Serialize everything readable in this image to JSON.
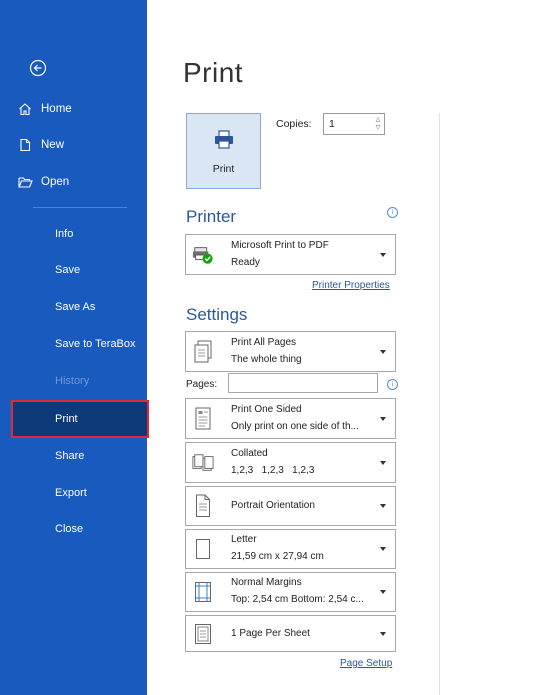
{
  "sidebar": {
    "top_items": [
      {
        "label": "Home",
        "icon": "home-icon"
      },
      {
        "label": "New",
        "icon": "new-document-icon"
      },
      {
        "label": "Open",
        "icon": "open-folder-icon"
      }
    ],
    "items": [
      {
        "label": "Info",
        "state": "normal"
      },
      {
        "label": "Save",
        "state": "normal"
      },
      {
        "label": "Save As",
        "state": "normal"
      },
      {
        "label": "Save to TeraBox",
        "state": "normal"
      },
      {
        "label": "History",
        "state": "disabled"
      },
      {
        "label": "Print",
        "state": "selected"
      },
      {
        "label": "Share",
        "state": "normal"
      },
      {
        "label": "Export",
        "state": "normal"
      },
      {
        "label": "Close",
        "state": "normal"
      }
    ]
  },
  "main": {
    "title": "Print",
    "print_button_label": "Print",
    "copies_label": "Copies:",
    "copies_value": "1",
    "printer_section": "Printer",
    "printer": {
      "name": "Microsoft Print to PDF",
      "status": "Ready"
    },
    "printer_properties_link": "Printer Properties",
    "settings_section": "Settings",
    "pages_label": "Pages:",
    "pages_value": "",
    "settings": [
      {
        "line1": "Print All Pages",
        "line2": "The whole thing",
        "icon": "pages-icon"
      },
      {
        "line1": "Print One Sided",
        "line2": "Only print on one side of th...",
        "icon": "one-sided-icon"
      },
      {
        "line1": "Collated",
        "line2": "1,2,3   1,2,3   1,2,3",
        "icon": "collated-icon"
      },
      {
        "line1": "Portrait Orientation",
        "line2": "",
        "icon": "portrait-icon"
      },
      {
        "line1": "Letter",
        "line2": "21,59 cm x 27,94 cm",
        "icon": "paper-size-icon"
      },
      {
        "line1": "Normal Margins",
        "line2": "Top: 2,54 cm Bottom: 2,54 c...",
        "icon": "margins-icon"
      },
      {
        "line1": "1 Page Per Sheet",
        "line2": "",
        "icon": "pages-per-sheet-icon"
      }
    ],
    "page_setup_link": "Page Setup"
  },
  "colors": {
    "sidebar_bg": "#185abd",
    "sidebar_selected": "#0d3a78",
    "selection_outline": "#e0293a",
    "accent_text": "#2b579a"
  }
}
